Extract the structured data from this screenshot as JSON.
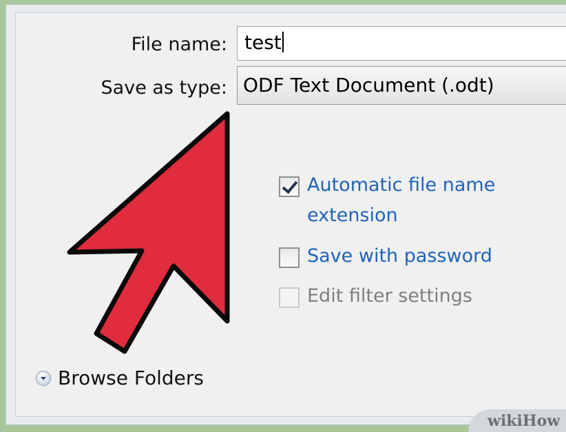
{
  "dialog": {
    "file_name_label": "File name:",
    "file_name_value": "test",
    "save_as_type_label": "Save as type:",
    "save_as_type_value": "ODF Text Document (.odt)"
  },
  "options": {
    "automatic_extension_line1": "Automatic file name",
    "automatic_extension_line2": "extension",
    "automatic_extension_checked": true,
    "save_with_password": "Save with password",
    "save_with_password_checked": false,
    "edit_filter_settings": "Edit filter settings",
    "edit_filter_settings_enabled": false
  },
  "browse_folders": "Browse Folders",
  "watermark": "wikiHow",
  "icons": {
    "arrow": "red-pointer-arrow-icon",
    "browse": "chevron-down-circle-icon"
  },
  "colors": {
    "arrow_fill": "#e02c3d",
    "link_blue": "#1f63b8",
    "background_green": "#a8c79a"
  }
}
